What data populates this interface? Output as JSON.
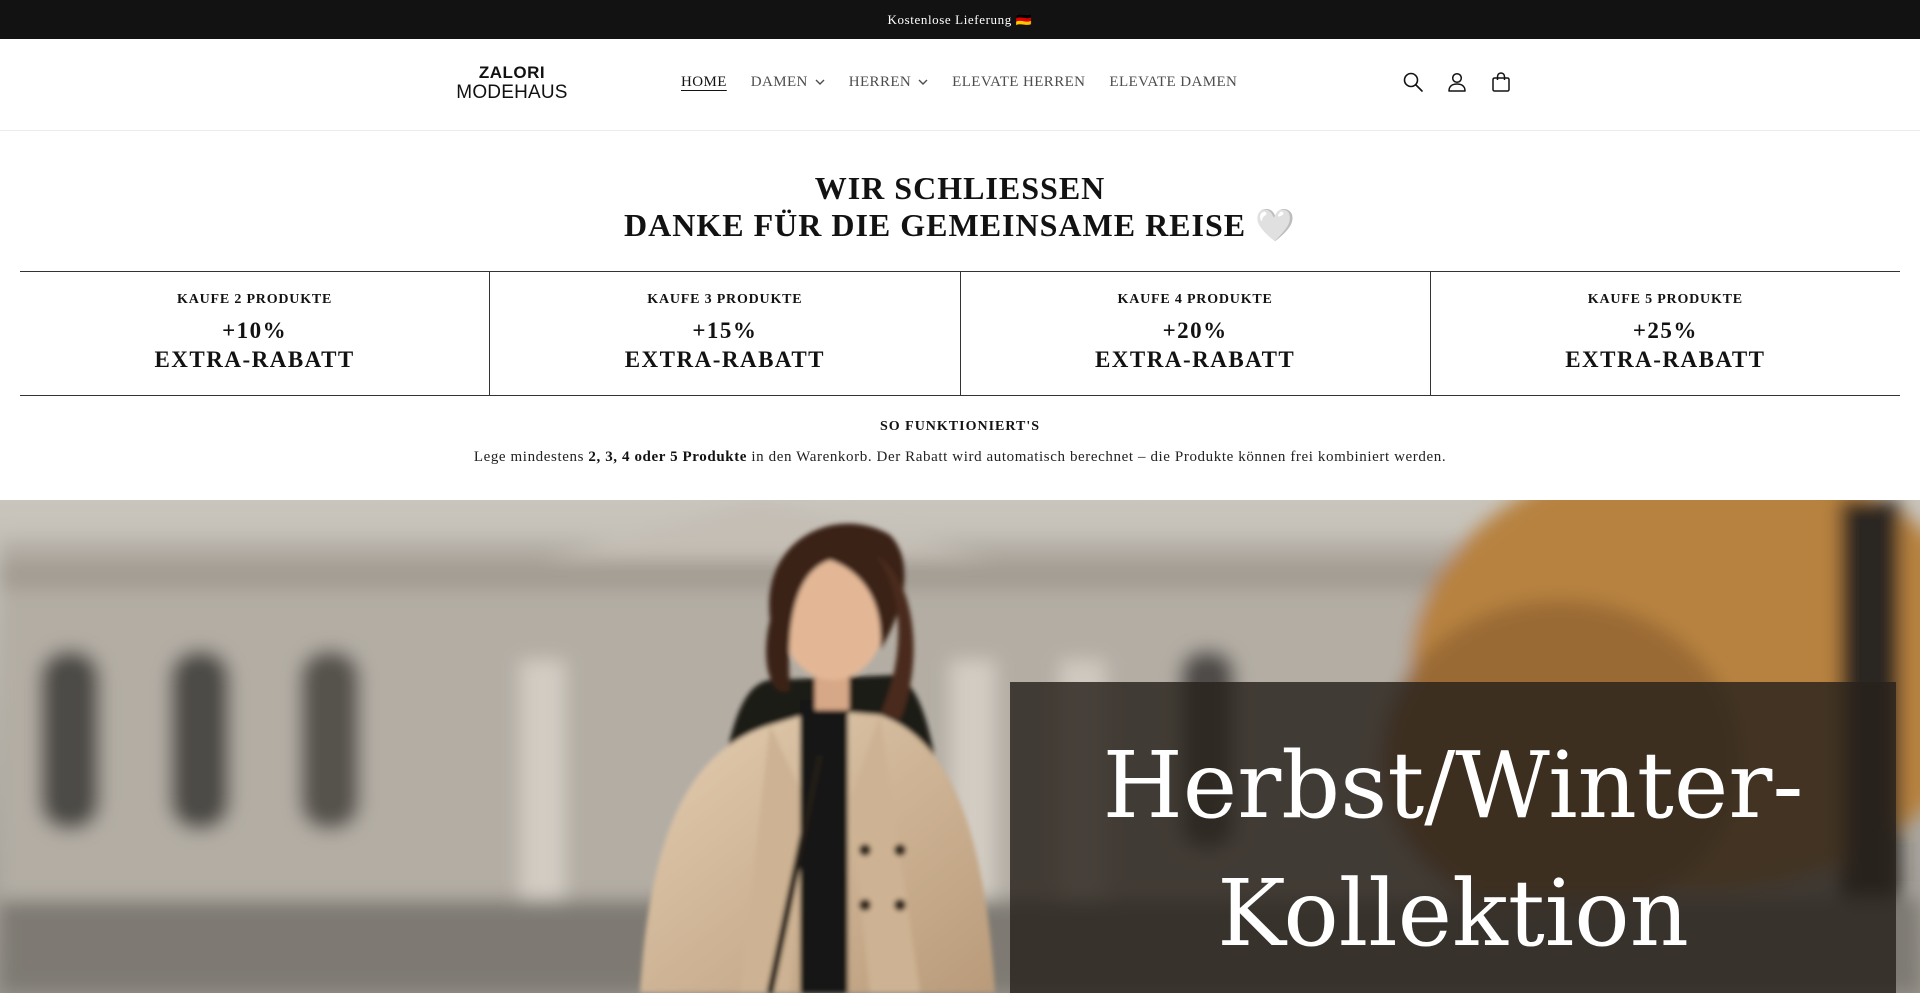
{
  "announcement": {
    "text": "Kostenlose Lieferung 🇩🇪"
  },
  "logo": {
    "line1": "ZALORI",
    "line2": "MODEHAUS"
  },
  "nav": {
    "items": [
      {
        "label": "HOME",
        "active": true,
        "dropdown": false
      },
      {
        "label": "DAMEN",
        "active": false,
        "dropdown": true
      },
      {
        "label": "HERREN",
        "active": false,
        "dropdown": true
      },
      {
        "label": "ELEVATE HERREN",
        "active": false,
        "dropdown": false
      },
      {
        "label": "ELEVATE DAMEN",
        "active": false,
        "dropdown": false
      }
    ]
  },
  "header_icons": [
    "search-icon",
    "account-icon",
    "cart-icon"
  ],
  "closing": {
    "line1": "WIR SCHLIESSEN",
    "line2": "DANKE FÜR DIE GEMEINSAME REISE 🤍"
  },
  "tiers": [
    {
      "heading": "KAUFE 2 PRODUKTE",
      "percent": "+10%",
      "label": "EXTRA-RABATT"
    },
    {
      "heading": "KAUFE 3 PRODUKTE",
      "percent": "+15%",
      "label": "EXTRA-RABATT"
    },
    {
      "heading": "KAUFE 4 PRODUKTE",
      "percent": "+20%",
      "label": "EXTRA-RABATT"
    },
    {
      "heading": "KAUFE 5 PRODUKTE",
      "percent": "+25%",
      "label": "EXTRA-RABATT"
    }
  ],
  "howto": {
    "title": "SO FUNKTIONIERT'S",
    "text_before": "Lege mindestens ",
    "text_bold": "2, 3, 4 oder 5 Produkte",
    "text_after": " in den Warenkorb. Der Rabatt wird automatisch berechnet – die Produkte können frei kombiniert werden."
  },
  "hero": {
    "title_line1": "Herbst/Winter-",
    "title_line2": "Kollektion"
  },
  "colors": {
    "announcement_bg": "#121212",
    "text": "#121212",
    "overlay": "#28221c"
  }
}
